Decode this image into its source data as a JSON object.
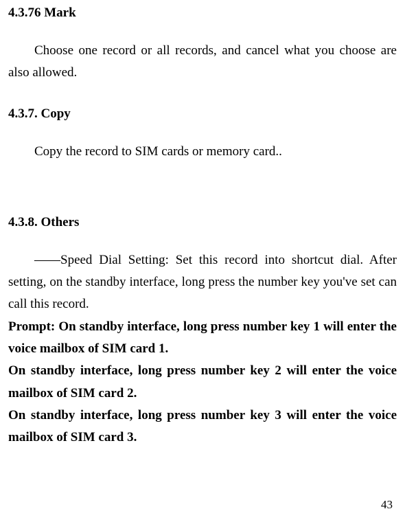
{
  "sections": {
    "mark": {
      "heading": "4.3.76 Mark",
      "body": "Choose one record or all records, and cancel what you choose are also allowed."
    },
    "copy": {
      "heading": "4.3.7. Copy",
      "body": "Copy the record to SIM cards or memory card.."
    },
    "others": {
      "heading": "4.3.8. Others",
      "speed_dial": "――Speed Dial Setting: Set this record into shortcut dial. After setting, on the standby interface, long press the number key you've set can call this record.",
      "prompt1": "Prompt: On standby interface, long press number key 1 will enter the voice mailbox of SIM card 1.",
      "prompt2": "On standby interface, long press number key 2 will enter the voice mailbox of SIM card 2.",
      "prompt3": "On standby interface, long press number key 3 will enter the voice mailbox of SIM card 3."
    }
  },
  "page_number": "43"
}
